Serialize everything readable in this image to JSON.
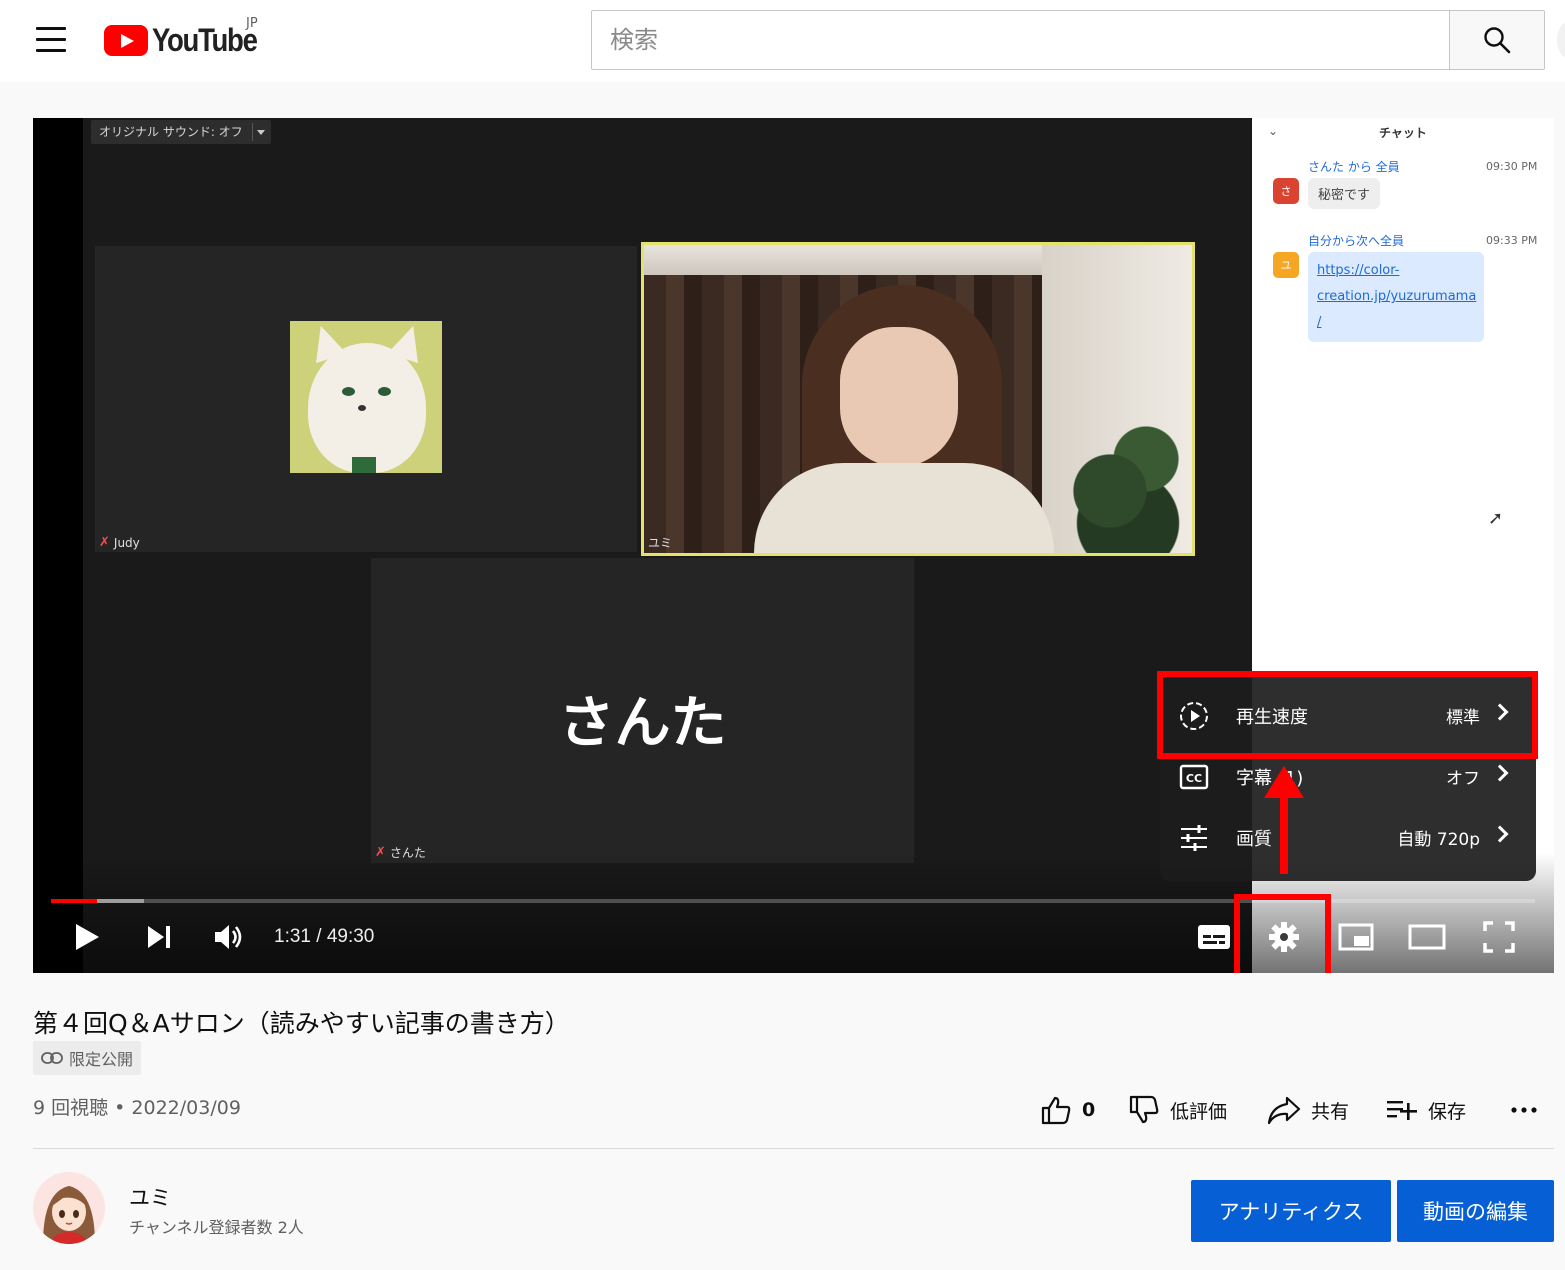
{
  "header": {
    "logo_text": "YouTube",
    "region": "JP",
    "search_placeholder": "検索"
  },
  "video_frame": {
    "sound_chip": "オリジナル サウンド: オフ",
    "tiles": [
      {
        "name": "Judy"
      },
      {
        "name": "ユミ"
      },
      {
        "name": "さんた",
        "big_label": "さんた"
      }
    ],
    "chat": {
      "title": "チャット",
      "messages": [
        {
          "from": "さんた から 全員",
          "time": "09:30 PM",
          "avatar": "さ",
          "text": "秘密です",
          "avatar_color": "#d9432f"
        },
        {
          "from": "自分から次へ全員",
          "time": "09:33 PM",
          "avatar": "ユ",
          "link_lines": [
            "https://color-",
            "creation.jp/yuzurumama",
            "/"
          ],
          "avatar_color": "#f5a623"
        }
      ]
    }
  },
  "settings_menu": {
    "items": [
      {
        "icon": "playback-speed-icon",
        "label": "再生速度",
        "value": "標準"
      },
      {
        "icon": "subtitles-cc-icon",
        "label": "字幕 (1)",
        "value": "オフ"
      },
      {
        "icon": "quality-sliders-icon",
        "label": "画質",
        "value": "自動 720p"
      }
    ]
  },
  "player": {
    "current_time": "1:31",
    "duration": "49:30",
    "time_display": "1:31 / 49:30",
    "progress_fraction": 0.031,
    "buffer_fraction": 0.063
  },
  "video": {
    "title": "第４回Q＆Aサロン（読みやすい記事の書き方）",
    "visibility": "限定公開",
    "views_date": "9 回視聴 • 2022/03/09",
    "like_count": "0",
    "dislike_label": "低評価",
    "share_label": "共有",
    "save_label": "保存"
  },
  "channel": {
    "name": "ユミ",
    "subscribers": "チャンネル登録者数 2人",
    "analytics_button": "アナリティクス",
    "edit_button": "動画の編集"
  },
  "colors": {
    "brand_red": "#ff0000",
    "button_blue": "#065fd4",
    "annotation_red": "#ff0000"
  }
}
